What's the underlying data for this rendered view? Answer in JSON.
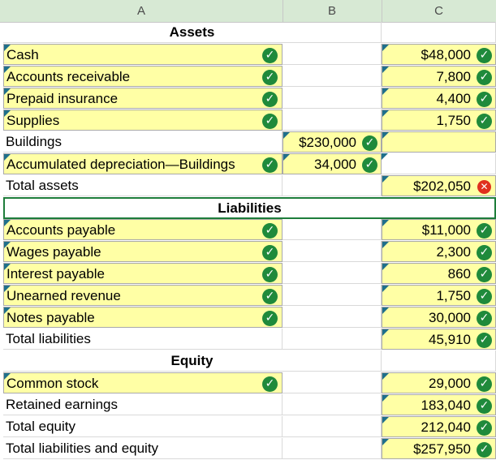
{
  "column_headers": [
    "A",
    "B",
    "C"
  ],
  "colors": {
    "check": "#1f8a3b",
    "error": "#e0301e",
    "input_fill": "#ffffa5",
    "header_fill": "#d7e9d4"
  },
  "sections": {
    "assets_header": "Assets",
    "liabilities_header": "Liabilities",
    "equity_header": "Equity"
  },
  "rows": {
    "cash": {
      "label": "Cash",
      "c": "$48,000"
    },
    "ar": {
      "label": "Accounts receivable",
      "c": "7,800"
    },
    "prepaid": {
      "label": "Prepaid insurance",
      "c": "4,400"
    },
    "supplies": {
      "label": "Supplies",
      "c": "1,750"
    },
    "buildings": {
      "label": "Buildings",
      "b": "$230,000"
    },
    "accdep": {
      "label": "Accumulated depreciation—Buildings",
      "b": "34,000"
    },
    "total_assets": {
      "label": "Total assets",
      "c": "$202,050"
    },
    "ap": {
      "label": "Accounts payable",
      "c": "$11,000"
    },
    "wages": {
      "label": "Wages payable",
      "c": "2,300"
    },
    "interest": {
      "label": "Interest payable",
      "c": "860"
    },
    "unearned": {
      "label": "Unearned revenue",
      "c": "1,750"
    },
    "notes": {
      "label": "Notes payable",
      "c": "30,000"
    },
    "total_liab": {
      "label": "Total liabilities",
      "c": "45,910"
    },
    "common": {
      "label": "Common stock",
      "c": "29,000"
    },
    "retained": {
      "label": "Retained earnings",
      "c": "183,040"
    },
    "total_equity": {
      "label": "Total equity",
      "c": "212,040"
    },
    "total_le": {
      "label": "Total liabilities and equity",
      "c": "$257,950"
    }
  }
}
